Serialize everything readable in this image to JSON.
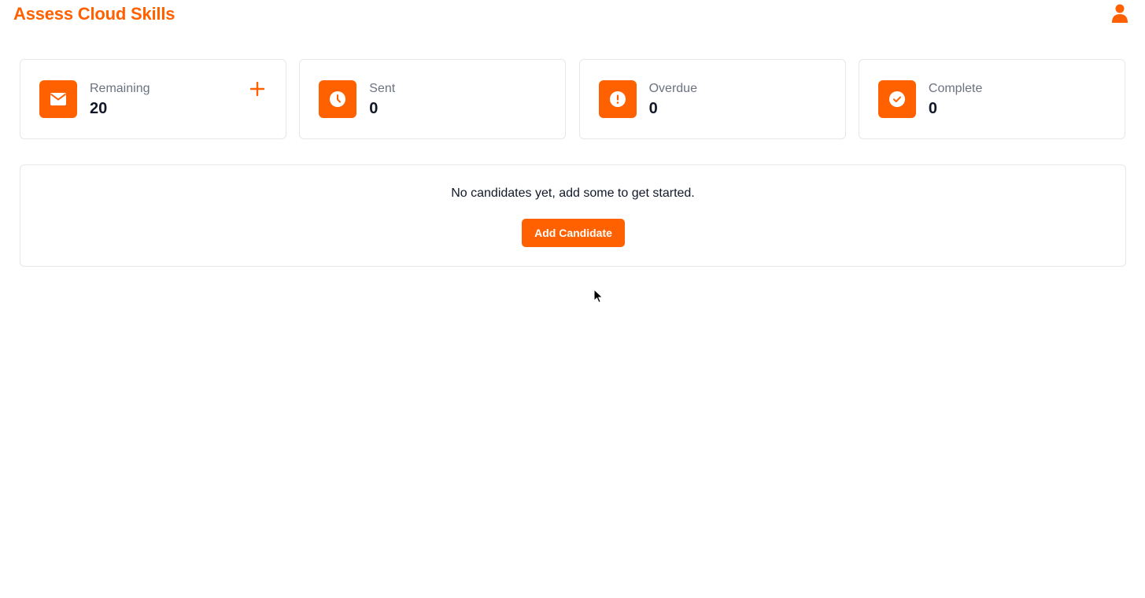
{
  "header": {
    "app_title": "Assess Cloud Skills",
    "user_icon": "user-icon"
  },
  "stats": [
    {
      "label": "Remaining",
      "value": "20",
      "icon": "envelope-icon",
      "has_add": true
    },
    {
      "label": "Sent",
      "value": "0",
      "icon": "clock-icon"
    },
    {
      "label": "Overdue",
      "value": "0",
      "icon": "exclamation-circle-icon"
    },
    {
      "label": "Complete",
      "value": "0",
      "icon": "check-circle-icon"
    }
  ],
  "empty_state": {
    "message": "No candidates yet, add some to get started.",
    "button_label": "Add Candidate"
  },
  "colors": {
    "accent": "#ff6000",
    "muted_text": "#6b7280",
    "border": "#e5e7eb"
  }
}
